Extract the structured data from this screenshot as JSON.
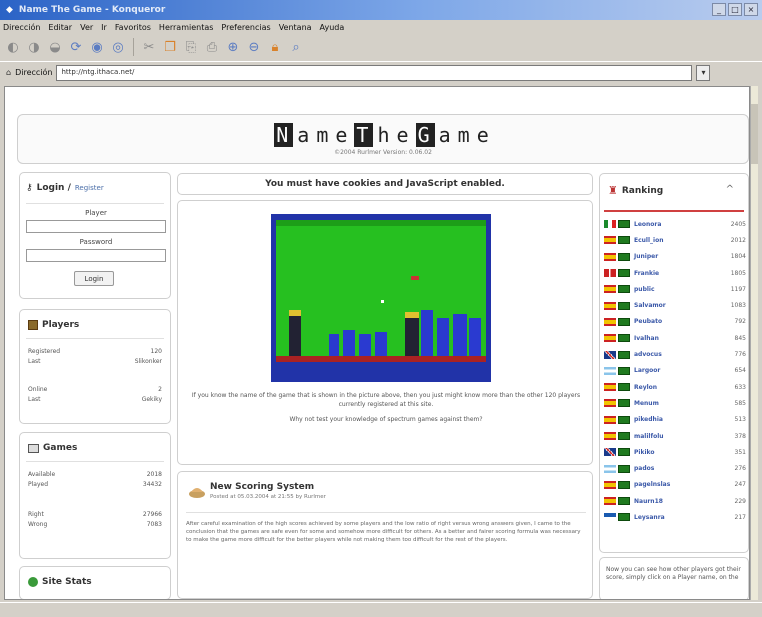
{
  "window": {
    "title": "Name The Game - Konqueror",
    "controls": [
      "_",
      "□",
      "×"
    ]
  },
  "menubar": [
    "Dirección",
    "Editar",
    "Ver",
    "Ir",
    "Favoritos",
    "Herramientas",
    "Preferencias",
    "Ventana",
    "Ayuda"
  ],
  "toolbar": {
    "icons": [
      "back-icon",
      "forward-icon",
      "up-icon",
      "reload-icon",
      "stop-icon",
      "home-icon",
      "cut-icon",
      "copy-icon",
      "paste-icon",
      "print-icon",
      "zoom-in-icon",
      "zoom-out-icon",
      "lock-icon",
      "find-icon"
    ]
  },
  "addressbar": {
    "label": "Dirección",
    "url": "http://ntg.ithaca.net/"
  },
  "header": {
    "logo_letters": [
      "N",
      "a",
      "m",
      "e",
      "T",
      "h",
      "e",
      "G",
      "a",
      "m",
      "e"
    ],
    "logo_word1": "Name",
    "logo_word2": "The",
    "logo_word3": "Game",
    "subtitle": "©2004 Rurlmer   Version: 0.06.02"
  },
  "login": {
    "title": "Login /",
    "register": "Register",
    "player_label": "Player",
    "password_label": "Password",
    "button": "Login"
  },
  "players": {
    "title": "Players",
    "rows": [
      {
        "k": "Registered",
        "v": "120"
      },
      {
        "k": "Last",
        "v": "Slikonker"
      },
      {
        "k": "Online",
        "v": "2"
      },
      {
        "k": "Last",
        "v": "Gekiky"
      }
    ]
  },
  "games": {
    "title": "Games",
    "rows": [
      {
        "k": "Available",
        "v": "2018"
      },
      {
        "k": "Played",
        "v": "34432"
      },
      {
        "k": "Right",
        "v": "27966"
      },
      {
        "k": "Wrong",
        "v": "7083"
      }
    ]
  },
  "sitestats": {
    "title": "Site Stats"
  },
  "center": {
    "warning": "You must have cookies and JavaScript enabled.",
    "game_text": "If you know the name of the game that is shown in the picture above, then you just might know more than the other 120 players currently registered at this site.",
    "game_text2": "Why not test your knowledge of spectrum games against them?"
  },
  "news": {
    "title": "New Scoring System",
    "meta": "Posted at 05.03.2004 at 21:55 by Rurlmer",
    "body": "After careful examination of the high scores achieved by some players and the low ratio of right versus wrong answers given, I came to the conclusion that the games are safe even for some and somehow more difficult for others. As a better and fairer scoring formula was necessary to make the game more difficult for the better players while not making them too difficult for the rest of the players."
  },
  "ranking": {
    "title": "Ranking",
    "toggle": "^",
    "rows": [
      {
        "flag": "it",
        "name": "Leonora",
        "score": "2405"
      },
      {
        "flag": "es",
        "name": "Ecull_ion",
        "score": "2012"
      },
      {
        "flag": "es",
        "name": "Juniper",
        "score": "1804"
      },
      {
        "flag": "dk",
        "name": "Frankie",
        "score": "1805"
      },
      {
        "flag": "es",
        "name": "public",
        "score": "1197"
      },
      {
        "flag": "es",
        "name": "Salvamor",
        "score": "1083"
      },
      {
        "flag": "es",
        "name": "Peubato",
        "score": "792"
      },
      {
        "flag": "es",
        "name": "Ivalhan",
        "score": "845"
      },
      {
        "flag": "gb",
        "name": "advocus",
        "score": "776"
      },
      {
        "flag": "ar",
        "name": "Largoor",
        "score": "654"
      },
      {
        "flag": "es",
        "name": "Reylon",
        "score": "633"
      },
      {
        "flag": "es",
        "name": "Menum",
        "score": "585"
      },
      {
        "flag": "es",
        "name": "pikedhia",
        "score": "513"
      },
      {
        "flag": "es",
        "name": "malilfolu",
        "score": "378"
      },
      {
        "flag": "gb",
        "name": "Pikiko",
        "score": "351"
      },
      {
        "flag": "ar",
        "name": "pados",
        "score": "276"
      },
      {
        "flag": "es",
        "name": "pagelnslas",
        "score": "247"
      },
      {
        "flag": "es",
        "name": "Naurn18",
        "score": "229"
      },
      {
        "flag": "gr",
        "name": "Leysanra",
        "score": "217"
      }
    ]
  },
  "info": {
    "text": "Now you can see how other players got their score, simply click on a Player name, on the"
  },
  "colors": {
    "screen_border": "#2133a8",
    "screen_field": "#26c020",
    "link": "#3a58a8",
    "rank_rule": "#d04040"
  }
}
